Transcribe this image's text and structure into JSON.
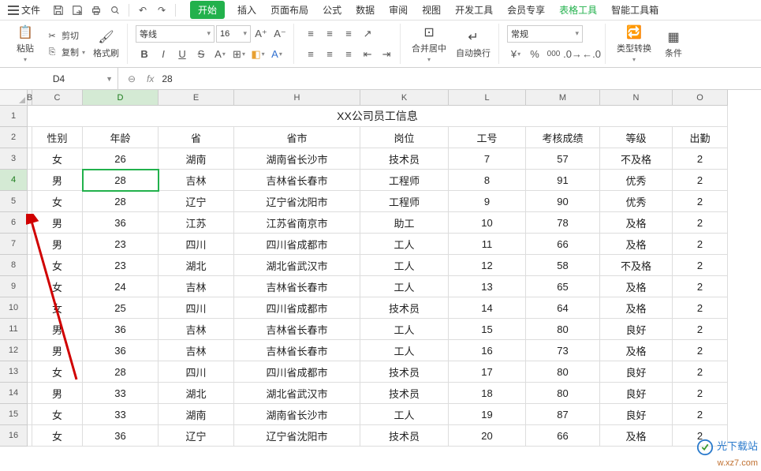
{
  "menubar": {
    "file": "文件",
    "tabs": [
      "开始",
      "插入",
      "页面布局",
      "公式",
      "数据",
      "审阅",
      "视图",
      "开发工具",
      "会员专享",
      "表格工具",
      "智能工具箱"
    ],
    "active_index": 0,
    "green_index": 9
  },
  "ribbon": {
    "paste": "粘贴",
    "cut": "剪切",
    "copy": "复制",
    "format_painter": "格式刷",
    "font_name": "等线",
    "font_size": "16",
    "merge": "合并居中",
    "autowrap": "自动换行",
    "number_fmt": "常规",
    "type_convert": "类型转换",
    "condition": "条件"
  },
  "formula": {
    "cellref": "D4",
    "fx": "fx",
    "value": "28"
  },
  "grid": {
    "columns": [
      {
        "id": "B",
        "cls": "w-hidden"
      },
      {
        "id": "C",
        "cls": "w-c"
      },
      {
        "id": "D",
        "cls": "w-d"
      },
      {
        "id": "E",
        "cls": "w-e"
      },
      {
        "id": "H",
        "cls": "w-h"
      },
      {
        "id": "K",
        "cls": "w-k"
      },
      {
        "id": "L",
        "cls": "w-l"
      },
      {
        "id": "M",
        "cls": "w-m"
      },
      {
        "id": "N",
        "cls": "w-n"
      },
      {
        "id": "O",
        "cls": "w-o"
      }
    ],
    "title": "XX公司员工信息",
    "headers": [
      "性别",
      "年龄",
      "省",
      "省市",
      "岗位",
      "工号",
      "考核成绩",
      "等级",
      "出勤"
    ],
    "rows": [
      [
        "女",
        "26",
        "湖南",
        "湖南省长沙市",
        "技术员",
        "7",
        "57",
        "不及格",
        "2"
      ],
      [
        "男",
        "28",
        "吉林",
        "吉林省长春市",
        "工程师",
        "8",
        "91",
        "优秀",
        "2"
      ],
      [
        "女",
        "28",
        "辽宁",
        "辽宁省沈阳市",
        "工程师",
        "9",
        "90",
        "优秀",
        "2"
      ],
      [
        "男",
        "36",
        "江苏",
        "江苏省南京市",
        "助工",
        "10",
        "78",
        "及格",
        "2"
      ],
      [
        "男",
        "23",
        "四川",
        "四川省成都市",
        "工人",
        "11",
        "66",
        "及格",
        "2"
      ],
      [
        "女",
        "23",
        "湖北",
        "湖北省武汉市",
        "工人",
        "12",
        "58",
        "不及格",
        "2"
      ],
      [
        "女",
        "24",
        "吉林",
        "吉林省长春市",
        "工人",
        "13",
        "65",
        "及格",
        "2"
      ],
      [
        "女",
        "25",
        "四川",
        "四川省成都市",
        "技术员",
        "14",
        "64",
        "及格",
        "2"
      ],
      [
        "男",
        "36",
        "吉林",
        "吉林省长春市",
        "工人",
        "15",
        "80",
        "良好",
        "2"
      ],
      [
        "男",
        "36",
        "吉林",
        "吉林省长春市",
        "工人",
        "16",
        "73",
        "及格",
        "2"
      ],
      [
        "女",
        "28",
        "四川",
        "四川省成都市",
        "技术员",
        "17",
        "80",
        "良好",
        "2"
      ],
      [
        "男",
        "33",
        "湖北",
        "湖北省武汉市",
        "技术员",
        "18",
        "80",
        "良好",
        "2"
      ],
      [
        "女",
        "33",
        "湖南",
        "湖南省长沙市",
        "工人",
        "19",
        "87",
        "良好",
        "2"
      ],
      [
        "女",
        "36",
        "辽宁",
        "辽宁省沈阳市",
        "技术员",
        "20",
        "66",
        "及格",
        "2"
      ]
    ],
    "active": {
      "row": 4,
      "col": "D"
    },
    "split_after_cols": [
      "B",
      "E",
      "H"
    ]
  },
  "watermark": {
    "line1": "光下载站",
    "line2": "w.xz7.com"
  }
}
